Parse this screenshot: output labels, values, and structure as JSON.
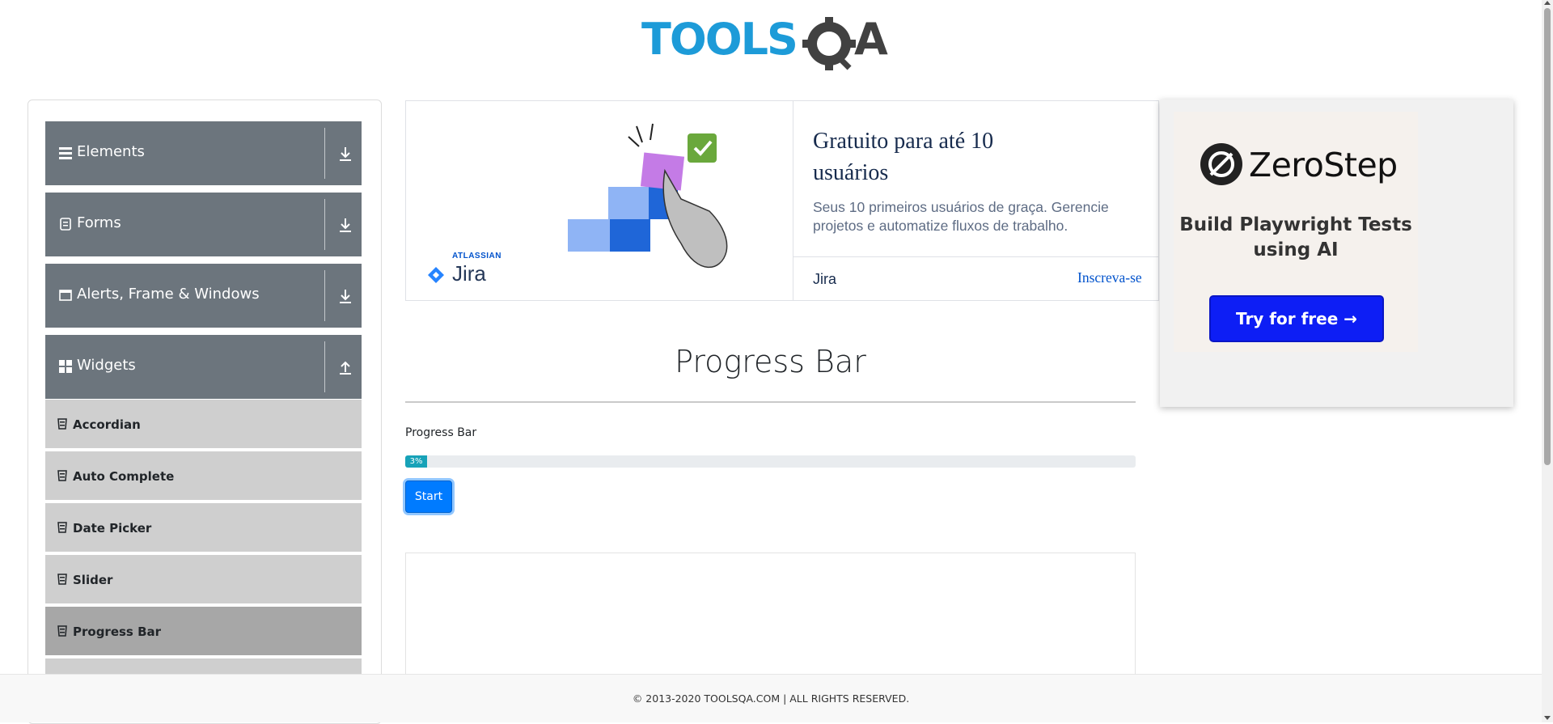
{
  "header": {
    "logo_text": "TOOLSQA"
  },
  "sidebar": {
    "groups": [
      {
        "label": "Elements",
        "icon": "menu-lines-icon",
        "expanded": false
      },
      {
        "label": "Forms",
        "icon": "document-icon",
        "expanded": false
      },
      {
        "label": "Alerts, Frame & Windows",
        "icon": "window-icon",
        "expanded": false
      },
      {
        "label": "Widgets",
        "icon": "grid-icon",
        "expanded": true
      }
    ],
    "items": [
      {
        "label": "Accordian",
        "active": false
      },
      {
        "label": "Auto Complete",
        "active": false
      },
      {
        "label": "Date Picker",
        "active": false
      },
      {
        "label": "Slider",
        "active": false
      },
      {
        "label": "Progress Bar",
        "active": true
      }
    ]
  },
  "ad_banner": {
    "headline": "Gratuito para até 10 usuários",
    "description": "Seus 10 primeiros usuários de graça. Gerencie projetos e automatize fluxos de trabalho.",
    "brand": "Jira",
    "cta": "Inscreva-se",
    "logo_small": "ATLASSIAN",
    "logo_name": "Jira"
  },
  "zerostep_ad": {
    "name": "ZeroStep",
    "tagline": "Build Playwright Tests using AI",
    "button": "Try for free →"
  },
  "main": {
    "title": "Progress Bar",
    "label": "Progress Bar",
    "progress_value": 3,
    "progress_text": "3%",
    "start_button": "Start"
  },
  "footer": {
    "text": "© 2013-2020 TOOLSQA.COM | ALL RIGHTS RESERVED."
  },
  "colors": {
    "sidebar_group": "#6c757d",
    "sidebar_item": "#cfcfcf",
    "sidebar_item_active": "#a7a7a7",
    "progress_fill": "#17a2b8",
    "start_button": "#007bff",
    "logo_blue": "#1d9bd8"
  }
}
